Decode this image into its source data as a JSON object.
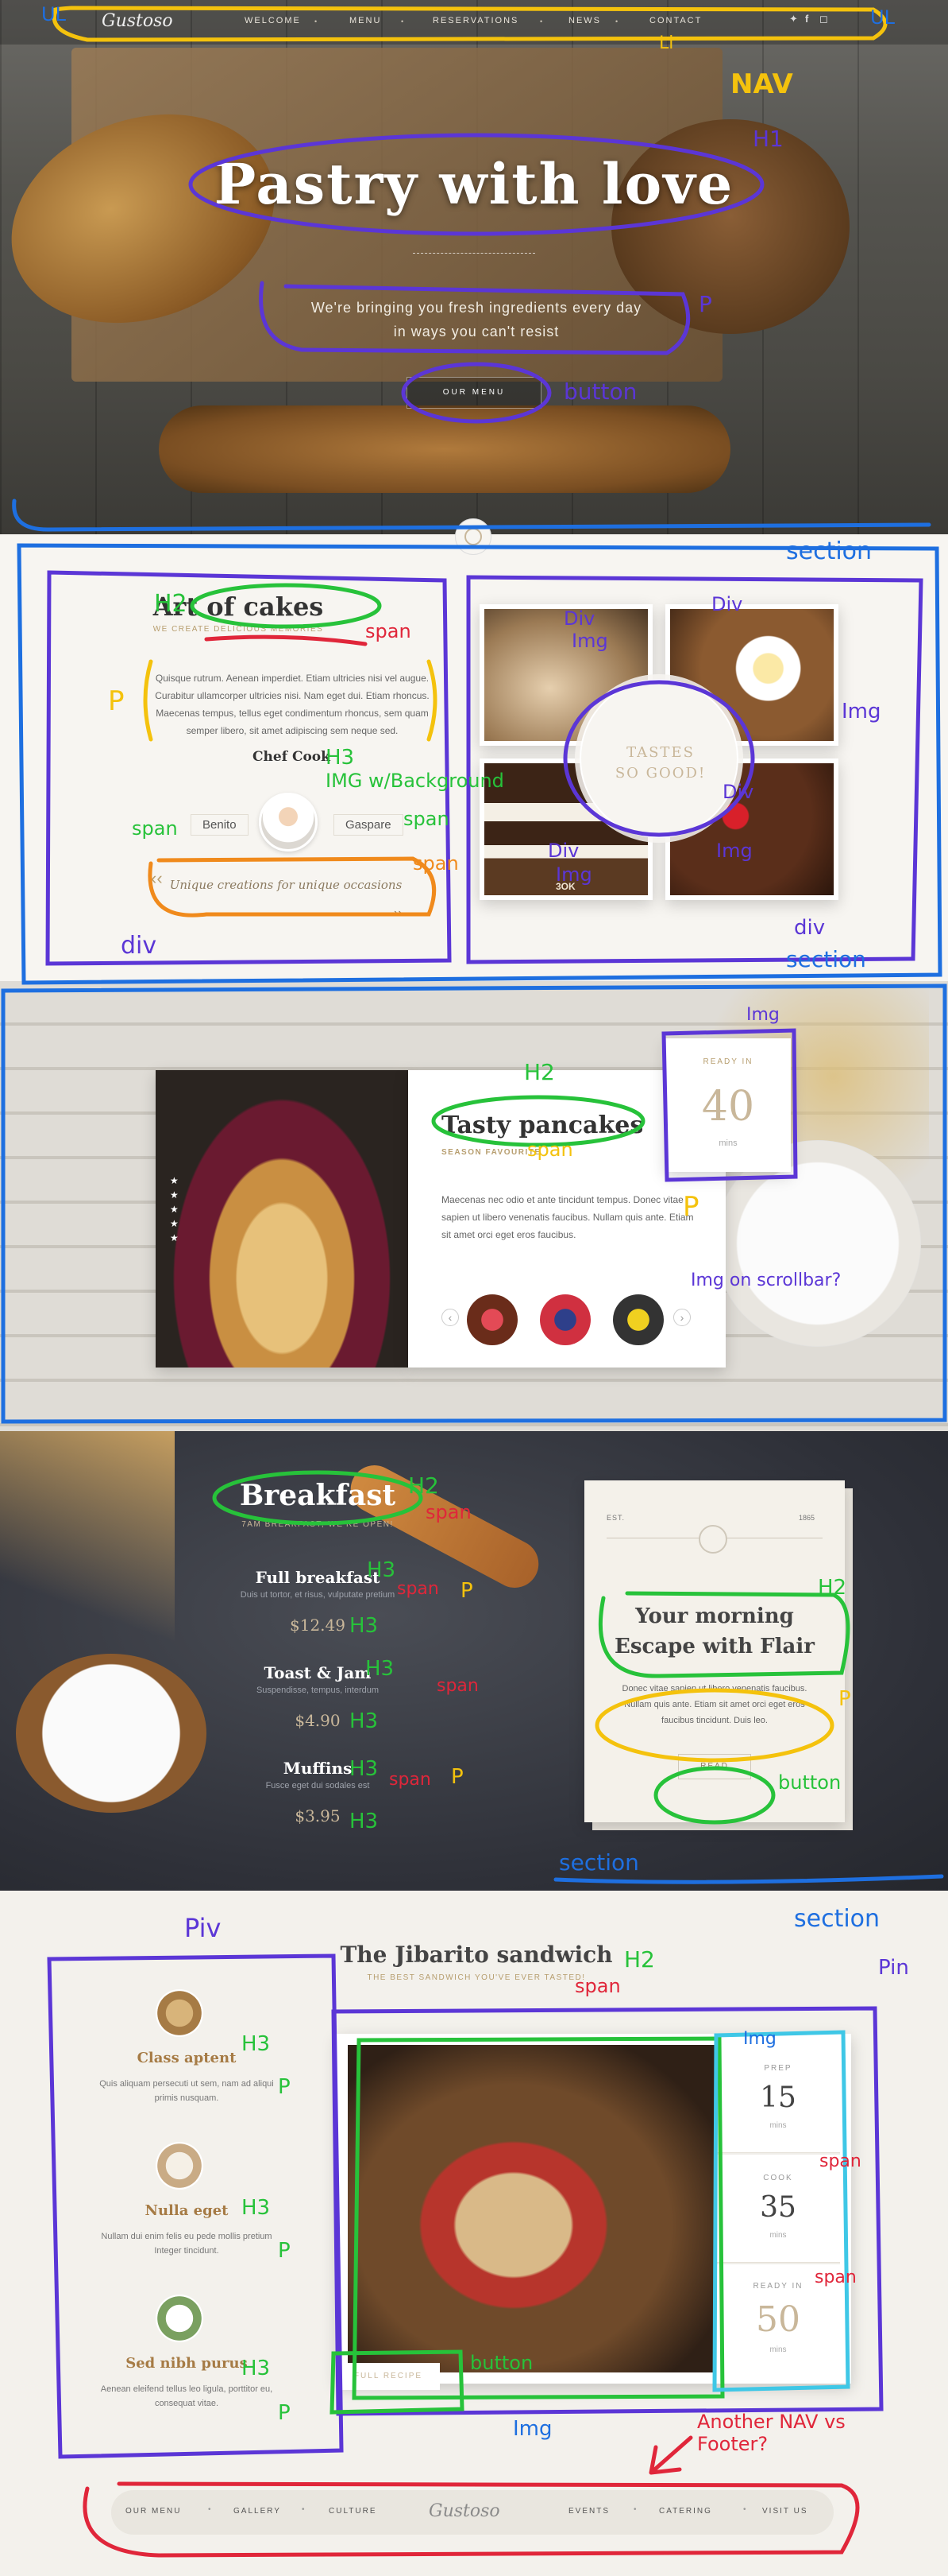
{
  "nav": {
    "logo": "Gustoso",
    "items": [
      "WELCOME",
      "MENU",
      "RESERVATIONS",
      "NEWS",
      "CONTACT"
    ],
    "social": [
      "twitter-icon",
      "facebook-icon",
      "instagram-icon"
    ]
  },
  "hero": {
    "title": "Pastry with love",
    "subtitle": "We're bringing you fresh ingredients every day in ways you can't resist",
    "button": "OUR MENU"
  },
  "cakes": {
    "title": "Art of cakes",
    "subtitle": "WE CREATE DELICIOUS MEMORIES",
    "text": "Quisque rutrum. Aenean imperdiet. Etiam ultricies nisi vel augue. Curabitur ullamcorper ultricies nisi. Nam eget dui. Etiam rhoncus. Maecenas tempus, tellus eget condimentum rhoncus, sem quam semper libero, sit amet adipiscing sem neque sed.",
    "chef_label": "Chef Cook",
    "chef_first": "Benito",
    "chef_last": "Gaspare",
    "signature": "Unique creations for unique occasions",
    "badge": "TASTES SO GOOD!",
    "cake_label": "3OK"
  },
  "pancakes": {
    "title": "Tasty pancakes",
    "subtitle": "SEASON FAVOURITE",
    "text": "Maecenas nec odio et ante tincidunt tempus. Donec vitae sapien ut libero venenatis faucibus. Nullam quis ante. Etiam sit amet orci eget eros faucibus.",
    "ready_label": "READY IN",
    "ready_value": "40",
    "ready_unit": "mins",
    "prev": "‹",
    "next": "›"
  },
  "breakfast": {
    "title": "Breakfast",
    "subtitle": "7AM BREAKFAST, WE'RE OPEN!",
    "items": [
      {
        "name": "Full breakfast",
        "desc": "Duis ut tortor, et risus, vulputate pretium",
        "price": "$12.49"
      },
      {
        "name": "Toast & Jam",
        "desc": "Suspendisse, tempus, interdum",
        "price": "$4.90"
      },
      {
        "name": "Muffins",
        "desc": "Fusce eget dui sodales est",
        "price": "$3.95"
      }
    ],
    "card": {
      "est": "EST.",
      "year": "1865",
      "title_line1": "Your morning",
      "title_line2": "Escape with Flair",
      "text": "Donec vitae sapien ut libero venenatis faucibus. Nullam quis ante. Etiam sit amet orci eget eros faucibus tincidunt. Duis leo.",
      "button": "READ"
    }
  },
  "jibarito": {
    "title": "The Jibarito sandwich",
    "subtitle": "THE BEST SANDWICH YOU'VE EVER TASTED!",
    "features": [
      {
        "title": "Class aptent",
        "text": "Quis aliquam persecuti ut sem, nam ad aliqui primis nusquam."
      },
      {
        "title": "Nulla eget",
        "text": "Nullam dui enim felis eu pede mollis pretium Integer tincidunt."
      },
      {
        "title": "Sed nibh purus",
        "text": "Aenean eleifend tellus leo ligula, porttitor eu, consequat vitae."
      }
    ],
    "stats": [
      {
        "label": "PREP",
        "value": "15",
        "unit": "mins"
      },
      {
        "label": "COOK",
        "value": "35",
        "unit": "mins"
      },
      {
        "label": "READY IN",
        "value": "50",
        "unit": "mins"
      }
    ],
    "recipe_button": "FULL RECIPE"
  },
  "footer": {
    "left": [
      "OUR MENU",
      "GALLERY",
      "CULTURE"
    ],
    "logo": "Gustoso",
    "right": [
      "EVENTS",
      "CATERING",
      "VISIT US"
    ]
  },
  "annotations": {
    "nav": "NAV",
    "ul": "UL",
    "li": "Li",
    "h1": "H1",
    "p": "P",
    "button": "button",
    "section": "section",
    "h2": "H2",
    "span": "span",
    "div": "Div",
    "img": "Img",
    "h3": "H3",
    "img_bg": "IMG w/Background",
    "div_lower": "div",
    "scrollbar": "Img on scrollbar?",
    "another_nav": "Another NAV vs Footer?",
    "piv": "Piv",
    "pin": "Pin"
  },
  "colors": {
    "accent": "#b79e6f",
    "text_dark": "#333333",
    "note_blue": "#1e6fe0",
    "note_purple": "#5b36d6",
    "note_green": "#27c23a",
    "note_red": "#e0263a",
    "note_yellow": "#f4c20d",
    "note_orange": "#f08a1c"
  }
}
